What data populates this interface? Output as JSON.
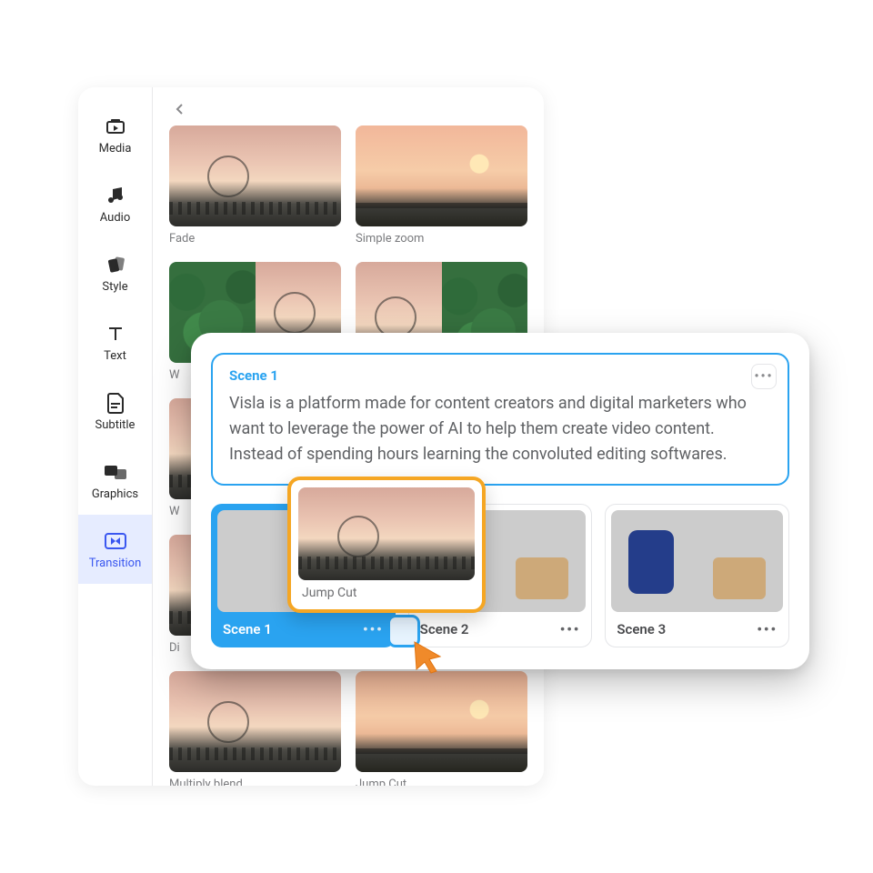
{
  "sidebar": {
    "items": [
      {
        "label": "Media"
      },
      {
        "label": "Audio"
      },
      {
        "label": "Style"
      },
      {
        "label": "Text"
      },
      {
        "label": "Subtitle"
      },
      {
        "label": "Graphics"
      },
      {
        "label": "Transition"
      }
    ],
    "active_index": 6
  },
  "transitions": [
    {
      "label": "Fade"
    },
    {
      "label": "Simple zoom"
    },
    {
      "label": "W"
    },
    {
      "label": ""
    },
    {
      "label": "W"
    },
    {
      "label": ""
    },
    {
      "label": "Di"
    },
    {
      "label": ""
    },
    {
      "label": "Multiply blend"
    },
    {
      "label": "Jump Cut"
    }
  ],
  "scene_editor": {
    "title": "Scene 1",
    "script": "Visla is a platform made for content creators and digital marketers who want to leverage the power of AI to help them create video content. Instead of spending hours learning the convoluted                                   editing softwares."
  },
  "scenes": [
    {
      "label": "Scene 1",
      "active": true
    },
    {
      "label": "Scene 2",
      "active": false
    },
    {
      "label": "Scene 3",
      "active": false
    }
  ],
  "drag": {
    "label": "Jump Cut"
  }
}
